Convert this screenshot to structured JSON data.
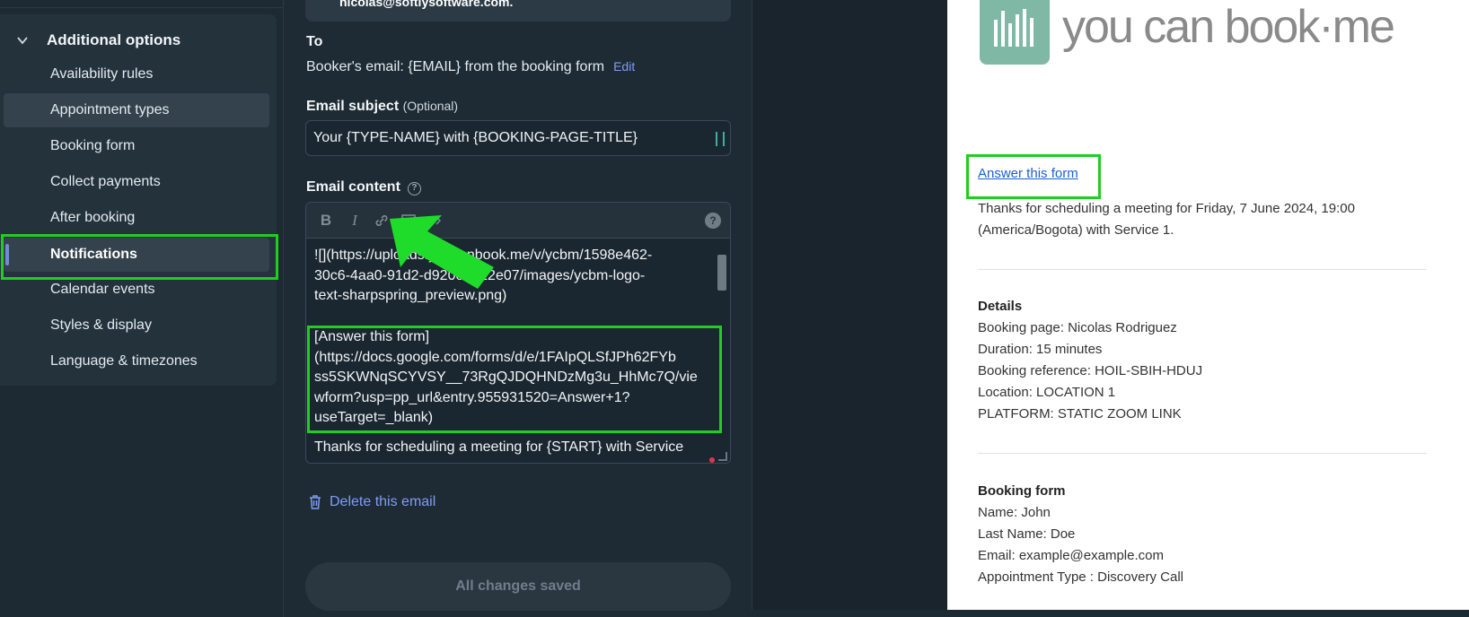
{
  "sidebar": {
    "header": "Additional options",
    "items": [
      "Availability rules",
      "Appointment types",
      "Booking form",
      "Collect payments",
      "After booking",
      "Notifications",
      "Calendar events",
      "Styles & display",
      "Language & timezones"
    ],
    "active": "Notifications"
  },
  "form": {
    "from_email": "nicolas@softlysoftware.com.",
    "to_label": "To",
    "to_value": "Booker's email: {EMAIL} from the booking form",
    "edit_label": "Edit",
    "subject_label": "Email subject",
    "subject_optional": "(Optional)",
    "subject_value": "Your {TYPE-NAME} with {BOOKING-PAGE-TITLE}",
    "content_label": "Email content",
    "content_help": "?",
    "toolbar": {
      "bold": "B",
      "italic": "I",
      "help": "?"
    },
    "content_lines_1": [
      "![](https://uploads.youcanbook.me/v/ycbm/1598e462-",
      "30c6-4aa0-91d2-d920e1612e07/images/ycbm-logo-",
      "text-sharpspring_preview.png)"
    ],
    "content_lines_2": [
      "[Answer this form]",
      "(https://docs.google.com/forms/d/e/1FAIpQLSfJPh62FYb",
      "ss5SKWNqSCYVSY__73RgQJDQHNDzMg3u_HhMc7Q/vie",
      "wform?usp=pp_url&entry.955931520=Answer+1?",
      "useTarget=_blank)"
    ],
    "content_line_3": "Thanks for scheduling a meeting for {START} with Service",
    "delete_label": "Delete this email",
    "save_label": "All changes saved"
  },
  "preview": {
    "logo_text": "you can book·me",
    "link": "Answer this form",
    "intro": [
      "Thanks for scheduling a meeting for Friday, 7 June 2024, 19:00",
      "(America/Bogota) with Service 1."
    ],
    "details_title": "Details",
    "details": [
      "Booking page: Nicolas Rodriguez",
      "Duration: 15 minutes",
      "Booking reference: HOIL-SBIH-HDUJ",
      "Location: LOCATION 1",
      "PLATFORM: STATIC ZOOM LINK"
    ],
    "form_title": "Booking form",
    "form": [
      "Name: John",
      "Last Name: Doe",
      "Email: example@example.com",
      "Appointment Type : Discovery Call"
    ]
  },
  "colors": {
    "highlight": "#22cc22",
    "link": "#7f9cf5",
    "logo": "#7fb9a6"
  }
}
